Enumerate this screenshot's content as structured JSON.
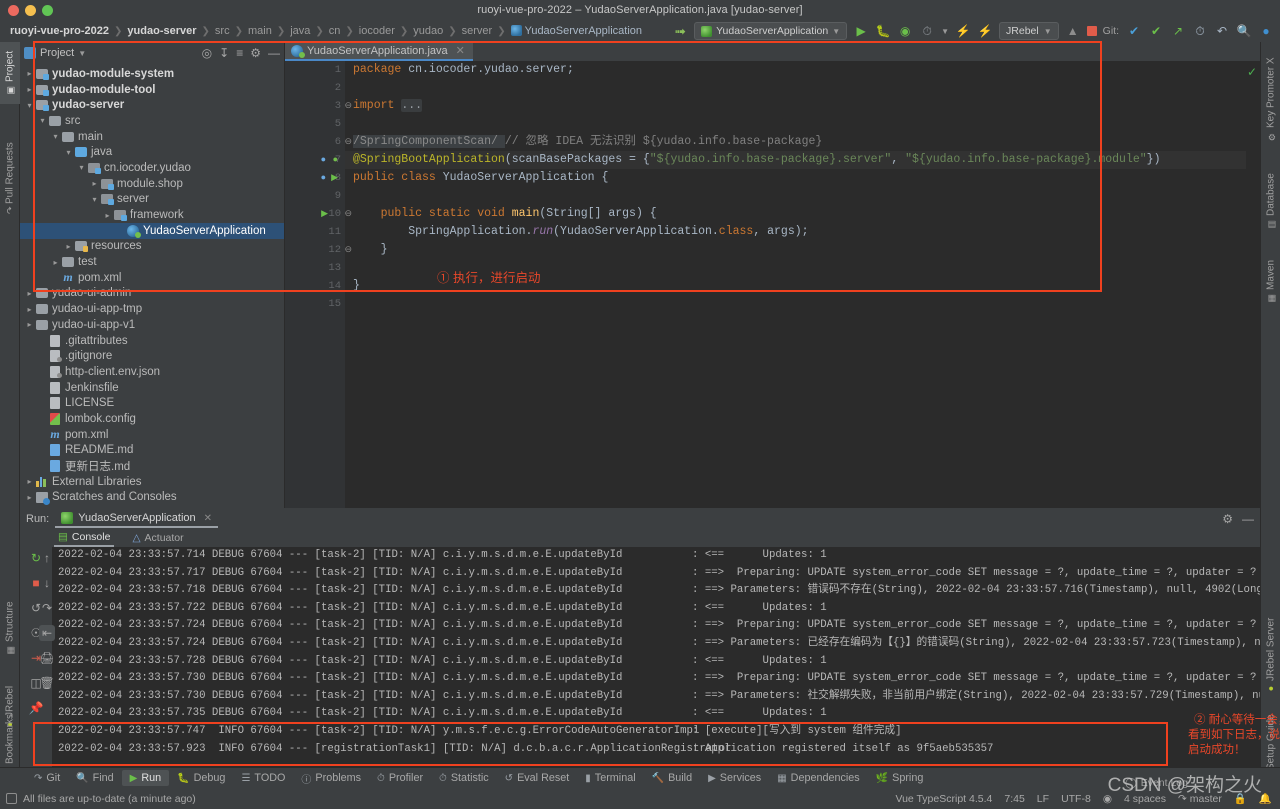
{
  "window": {
    "title": "ruoyi-vue-pro-2022 – YudaoServerApplication.java [yudao-server]"
  },
  "breadcrumb": {
    "items": [
      {
        "label": "ruoyi-vue-pro-2022",
        "style": "bold"
      },
      {
        "label": "yudao-server",
        "style": "bold"
      },
      {
        "label": "src",
        "style": "dim"
      },
      {
        "label": "main",
        "style": "dim"
      },
      {
        "label": "java",
        "style": "dim"
      },
      {
        "label": "cn",
        "style": "dim"
      },
      {
        "label": "iocoder",
        "style": "dim"
      },
      {
        "label": "yudao",
        "style": "dim"
      },
      {
        "label": "server",
        "style": "dim"
      },
      {
        "label": "YudaoServerApplication",
        "style": "file"
      }
    ]
  },
  "toolbar": {
    "back_icon": "back-arrow-icon",
    "run_config": "YudaoServerApplication",
    "run_icon": "run-icon",
    "debug_icon": "debug-icon",
    "coverage_icon": "run-with-coverage-icon",
    "profiler_icon": "profiler-icon",
    "jrebel_run_icon": "jrebel-run-icon",
    "jrebel_debug_icon": "jrebel-debug-icon",
    "jrebel_label": "JRebel",
    "attach_icon": "attach-icon",
    "stop_icon": "stop-icon",
    "git_label": "Git:",
    "git_update_icon": "git-update-icon",
    "git_commit_icon": "git-commit-icon",
    "git_push_icon": "git-push-icon",
    "history_icon": "history-icon",
    "rollback_icon": "rollback-icon",
    "search_icon": "search-everywhere-icon",
    "account_icon": "account-icon"
  },
  "left_strip": {
    "tabs": [
      {
        "label": "Project",
        "icon": "project-icon",
        "selected": true
      },
      {
        "label": "Pull Requests",
        "icon": "pull-request-icon",
        "selected": false
      }
    ],
    "bottom_tabs": [
      {
        "label": "Structure",
        "icon": "structure-icon"
      },
      {
        "label": "JRebel",
        "icon": "jrebel-icon"
      },
      {
        "label": "Bookmarks",
        "icon": "bookmark-icon"
      }
    ]
  },
  "right_strip": {
    "tabs": [
      {
        "label": "Key Promoter X",
        "icon": "key-promoter-icon"
      },
      {
        "label": "Database",
        "icon": "database-icon"
      },
      {
        "label": "Maven",
        "icon": "maven-icon"
      }
    ],
    "bottom_tabs": [
      {
        "label": "JRebel Server",
        "icon": "jrebel-server-icon"
      },
      {
        "label": "Setup Guide",
        "icon": "setup-guide-icon"
      }
    ]
  },
  "project_panel": {
    "title": "Project",
    "dropdown_icon": "chevron-down-icon",
    "actions": [
      "locate-icon",
      "expand-all-icon",
      "collapse-all-icon",
      "settings-icon",
      "hide-icon"
    ],
    "tree": [
      {
        "indent": 0,
        "arrow": "right",
        "icon": "module-folder",
        "label": "yudao-module-system",
        "bold": true,
        "selected": false
      },
      {
        "indent": 0,
        "arrow": "right",
        "icon": "module-folder",
        "label": "yudao-module-tool",
        "bold": true,
        "selected": false
      },
      {
        "indent": 0,
        "arrow": "down",
        "icon": "module-folder",
        "label": "yudao-server",
        "bold": true,
        "selected": false
      },
      {
        "indent": 1,
        "arrow": "down",
        "icon": "folder-grey",
        "label": "src",
        "bold": false,
        "selected": false
      },
      {
        "indent": 2,
        "arrow": "down",
        "icon": "folder-grey",
        "label": "main",
        "bold": false,
        "selected": false
      },
      {
        "indent": 3,
        "arrow": "down",
        "icon": "folder-blue",
        "label": "java",
        "bold": false,
        "selected": false
      },
      {
        "indent": 4,
        "arrow": "down",
        "icon": "package",
        "label": "cn.iocoder.yudao",
        "bold": false,
        "selected": false
      },
      {
        "indent": 5,
        "arrow": "right",
        "icon": "package",
        "label": "module.shop",
        "bold": false,
        "selected": false
      },
      {
        "indent": 5,
        "arrow": "down",
        "icon": "package",
        "label": "server",
        "bold": false,
        "selected": false
      },
      {
        "indent": 6,
        "arrow": "right",
        "icon": "package",
        "label": "framework",
        "bold": false,
        "selected": false
      },
      {
        "indent": 7,
        "arrow": "none",
        "icon": "spring-class",
        "label": "YudaoServerApplication",
        "bold": false,
        "selected": true
      },
      {
        "indent": 3,
        "arrow": "right",
        "icon": "folder-res",
        "label": "resources",
        "bold": false,
        "selected": false
      },
      {
        "indent": 2,
        "arrow": "right",
        "icon": "folder-grey",
        "label": "test",
        "bold": false,
        "selected": false
      },
      {
        "indent": 2,
        "arrow": "none",
        "icon": "maven-file",
        "label": "pom.xml",
        "bold": false,
        "selected": false
      },
      {
        "indent": 0,
        "arrow": "right",
        "icon": "folder-grey",
        "label": "yudao-ui-admin",
        "bold": false,
        "selected": false
      },
      {
        "indent": 0,
        "arrow": "right",
        "icon": "folder-grey",
        "label": "yudao-ui-app-tmp",
        "bold": false,
        "selected": false
      },
      {
        "indent": 0,
        "arrow": "right",
        "icon": "folder-grey",
        "label": "yudao-ui-app-v1",
        "bold": false,
        "selected": false
      },
      {
        "indent": 1,
        "arrow": "none",
        "icon": "file",
        "label": ".gitattributes",
        "bold": false,
        "selected": false
      },
      {
        "indent": 1,
        "arrow": "none",
        "icon": "file-ignore",
        "label": ".gitignore",
        "bold": false,
        "selected": false
      },
      {
        "indent": 1,
        "arrow": "none",
        "icon": "file-json",
        "label": "http-client.env.json",
        "bold": false,
        "selected": false
      },
      {
        "indent": 1,
        "arrow": "none",
        "icon": "file",
        "label": "Jenkinsfile",
        "bold": false,
        "selected": false
      },
      {
        "indent": 1,
        "arrow": "none",
        "icon": "file",
        "label": "LICENSE",
        "bold": false,
        "selected": false
      },
      {
        "indent": 1,
        "arrow": "none",
        "icon": "file-lombok",
        "label": "lombok.config",
        "bold": false,
        "selected": false
      },
      {
        "indent": 1,
        "arrow": "none",
        "icon": "maven-file",
        "label": "pom.xml",
        "bold": false,
        "selected": false
      },
      {
        "indent": 1,
        "arrow": "none",
        "icon": "file-md",
        "label": "README.md",
        "bold": false,
        "selected": false
      },
      {
        "indent": 1,
        "arrow": "none",
        "icon": "file-md",
        "label": "更新日志.md",
        "bold": false,
        "selected": false
      },
      {
        "indent": 0,
        "arrow": "right",
        "icon": "libraries",
        "label": "External Libraries",
        "bold": false,
        "selected": false
      },
      {
        "indent": 0,
        "arrow": "right",
        "icon": "scratches",
        "label": "Scratches and Consoles",
        "bold": false,
        "selected": false
      }
    ]
  },
  "editor": {
    "tab": {
      "label": "YudaoServerApplication.java",
      "icon": "spring-class-icon",
      "close_icon": "close-icon"
    },
    "inspection_ok_icon": "inspection-ok-check",
    "lines": [
      {
        "no": "1",
        "gutter": "",
        "segments": [
          {
            "t": "package ",
            "c": "kw"
          },
          {
            "t": "cn.iocoder.yudao.server;",
            "c": ""
          }
        ]
      },
      {
        "no": "2",
        "gutter": "",
        "segments": []
      },
      {
        "no": "3",
        "gutter": "fold",
        "segments": [
          {
            "t": "import ",
            "c": "kw"
          },
          {
            "t": "...",
            "c": "folded"
          }
        ]
      },
      {
        "no": "5",
        "gutter": "",
        "segments": []
      },
      {
        "no": "6",
        "gutter": "fold",
        "segments": [
          {
            "t": "/SpringComponentScan/ ",
            "c": "cmt-box"
          },
          {
            "t": "// 忽略 IDEA 无法识别 ${yudao.info.base-package}",
            "c": "cmt"
          }
        ]
      },
      {
        "no": "7",
        "gutter": "spring-run",
        "segments": [
          {
            "t": "@SpringBootApplication",
            "c": "ann"
          },
          {
            "t": "(scanBasePackages = {",
            "c": ""
          },
          {
            "t": "\"${yudao.info.base-package}.server\"",
            "c": "str"
          },
          {
            "t": ", ",
            "c": ""
          },
          {
            "t": "\"${yudao.info.base-package}.module\"",
            "c": "str"
          },
          {
            "t": "})",
            "c": ""
          }
        ]
      },
      {
        "no": "8",
        "gutter": "run-green",
        "segments": [
          {
            "t": "public class ",
            "c": "kw"
          },
          {
            "t": "YudaoServerApplication ",
            "c": ""
          },
          {
            "t": "{",
            "c": ""
          }
        ]
      },
      {
        "no": "9",
        "gutter": "",
        "segments": []
      },
      {
        "no": "10",
        "gutter": "run-arrow",
        "segments": [
          {
            "t": "    public static void ",
            "c": "kw"
          },
          {
            "t": "main",
            "c": "fn"
          },
          {
            "t": "(String[] args) {",
            "c": ""
          }
        ]
      },
      {
        "no": "11",
        "gutter": "",
        "segments": [
          {
            "t": "        SpringApplication.",
            "c": ""
          },
          {
            "t": "run",
            "c": "ital"
          },
          {
            "t": "(YudaoServerApplication.",
            "c": ""
          },
          {
            "t": "class",
            "c": "kw"
          },
          {
            "t": ", args);",
            "c": ""
          }
        ]
      },
      {
        "no": "12",
        "gutter": "fold",
        "segments": [
          {
            "t": "    }",
            "c": ""
          }
        ]
      },
      {
        "no": "13",
        "gutter": "",
        "segments": []
      },
      {
        "no": "14",
        "gutter": "",
        "segments": [
          {
            "t": "}",
            "c": ""
          }
        ]
      },
      {
        "no": "15",
        "gutter": "",
        "segments": []
      }
    ],
    "annotation_1": "① 执行，进行启动"
  },
  "run_panel": {
    "label": "Run:",
    "config_name": "YudaoServerApplication",
    "config_icon": "spring-run-icon",
    "close_icon": "close-icon",
    "settings_icon": "settings-icon",
    "hide_icon": "hide-icon",
    "tabs": [
      {
        "label": "Console",
        "icon": "console-icon",
        "selected": true
      },
      {
        "label": "Actuator",
        "icon": "actuator-icon",
        "selected": false
      }
    ],
    "side_buttons_left": [
      "rerun-icon",
      "stop-icon",
      "restart-icon",
      "camera-icon",
      "export-icon",
      "layout-icon",
      "pin-icon"
    ],
    "side_buttons_right": [
      "up-icon",
      "down-icon",
      "soft-wrap-icon",
      "scroll-to-end-icon",
      "print-icon",
      "trash-icon"
    ],
    "annotation_2": [
      "② 耐心等待一会，",
      "看到如下日志，说明",
      "启动成功！"
    ],
    "log_lines": [
      {
        "left": "2022-02-04 23:33:57.714 DEBUG 67604 --- [task-2] [TID: N/A] c.i.y.m.s.d.m.e.E.updateById",
        "right": ": <==      Updates: 1",
        "level": "DEBUG"
      },
      {
        "left": "2022-02-04 23:33:57.717 DEBUG 67604 --- [task-2] [TID: N/A] c.i.y.m.s.d.m.e.E.updateById",
        "right": ": ==>  Preparing: UPDATE system_error_code SET message = ?, update_time = ?, updater = ?",
        "level": "DEBUG"
      },
      {
        "left": "2022-02-04 23:33:57.718 DEBUG 67604 --- [task-2] [TID: N/A] c.i.y.m.s.d.m.e.E.updateById",
        "right": ": ==> Parameters: 错误码不存在(String), 2022-02-04 23:33:57.716(Timestamp), null, 4902(Long",
        "level": "DEBUG"
      },
      {
        "left": "2022-02-04 23:33:57.722 DEBUG 67604 --- [task-2] [TID: N/A] c.i.y.m.s.d.m.e.E.updateById",
        "right": ": <==      Updates: 1",
        "level": "DEBUG"
      },
      {
        "left": "2022-02-04 23:33:57.724 DEBUG 67604 --- [task-2] [TID: N/A] c.i.y.m.s.d.m.e.E.updateById",
        "right": ": ==>  Preparing: UPDATE system_error_code SET message = ?, update_time = ?, updater = ?",
        "level": "DEBUG"
      },
      {
        "left": "2022-02-04 23:33:57.724 DEBUG 67604 --- [task-2] [TID: N/A] c.i.y.m.s.d.m.e.E.updateById",
        "right": ": ==> Parameters: 已经存在编码为【{}】的错误码(String), 2022-02-04 23:33:57.723(Timestamp), nu",
        "level": "DEBUG"
      },
      {
        "left": "2022-02-04 23:33:57.728 DEBUG 67604 --- [task-2] [TID: N/A] c.i.y.m.s.d.m.e.E.updateById",
        "right": ": <==      Updates: 1",
        "level": "DEBUG"
      },
      {
        "left": "2022-02-04 23:33:57.730 DEBUG 67604 --- [task-2] [TID: N/A] c.i.y.m.s.d.m.e.E.updateById",
        "right": ": ==>  Preparing: UPDATE system_error_code SET message = ?, update_time = ?, updater = ?",
        "level": "DEBUG"
      },
      {
        "left": "2022-02-04 23:33:57.730 DEBUG 67604 --- [task-2] [TID: N/A] c.i.y.m.s.d.m.e.E.updateById",
        "right": ": ==> Parameters: 社交解绑失败，非当前用户绑定(String), 2022-02-04 23:33:57.729(Timestamp), nu",
        "level": "DEBUG"
      },
      {
        "left": "2022-02-04 23:33:57.735 DEBUG 67604 --- [task-2] [TID: N/A] c.i.y.m.s.d.m.e.E.updateById",
        "right": ": <==      Updates: 1",
        "level": "DEBUG"
      },
      {
        "left": "2022-02-04 23:33:57.747  INFO 67604 --- [task-2] [TID: N/A] y.m.s.f.e.c.g.ErrorCodeAutoGeneratorImpl",
        "right": ": [execute][写入到 system 组件完成]",
        "level": "INFO"
      },
      {
        "left": "2022-02-04 23:33:57.923  INFO 67604 --- [registrationTask1] [TID: N/A] d.c.b.a.c.r.ApplicationRegistrator",
        "right": ": Application registered itself as 9f5aeb535357",
        "level": "INFO"
      }
    ]
  },
  "bottom_bar": {
    "items": [
      {
        "label": "Git",
        "icon": "git-branch-icon",
        "selected": false
      },
      {
        "label": "Find",
        "icon": "search-icon",
        "selected": false
      },
      {
        "label": "Run",
        "icon": "run-icon",
        "selected": true
      },
      {
        "label": "Debug",
        "icon": "debug-icon",
        "selected": false
      },
      {
        "label": "TODO",
        "icon": "todo-list-icon",
        "selected": false
      },
      {
        "label": "Problems",
        "icon": "problems-icon",
        "selected": false
      },
      {
        "label": "Profiler",
        "icon": "profiler-icon",
        "selected": false
      },
      {
        "label": "Statistic",
        "icon": "statistic-icon",
        "selected": false
      },
      {
        "label": "Eval Reset",
        "icon": "eval-reset-icon",
        "selected": false
      },
      {
        "label": "Terminal",
        "icon": "terminal-icon",
        "selected": false
      },
      {
        "label": "Build",
        "icon": "build-hammer-icon",
        "selected": false
      },
      {
        "label": "Services",
        "icon": "services-icon",
        "selected": false
      },
      {
        "label": "Dependencies",
        "icon": "dependencies-icon",
        "selected": false
      },
      {
        "label": "Spring",
        "icon": "spring-leaf-icon",
        "selected": false
      }
    ]
  },
  "status_bar": {
    "message": "All files are up-to-date (a minute ago)",
    "message_icon": "document-icon",
    "event_log": "Event Log",
    "event_log_icon": "event-log-icon",
    "framework": "Vue TypeScript 4.5.4",
    "caret": "7:45",
    "line_sep": "LF",
    "encoding": "UTF-8",
    "read_only_icon": "lock-open-icon",
    "indent": "4 spaces",
    "branch": "master",
    "branch_icon": "git-branch-icon",
    "inspection_icon": "inspections-icon",
    "notification_icon": "notification-bell-icon"
  },
  "watermark": {
    "text": "CSDN @架构之火"
  },
  "colors": {
    "accent_red": "#f0411f",
    "annotation_red": "#e8472a",
    "selection_blue": "#2d5177",
    "editor_bg": "#2b2b2b",
    "panel_bg": "#3c3f41",
    "tab_underline": "#4a88c7"
  }
}
